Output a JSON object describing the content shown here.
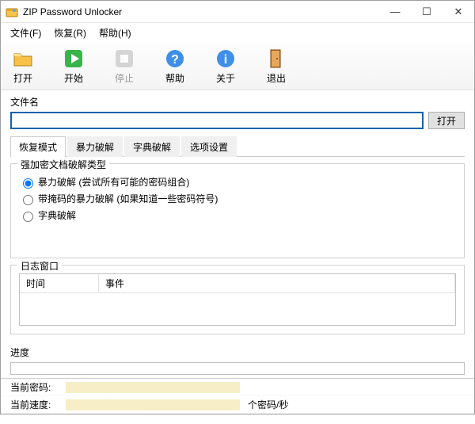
{
  "window": {
    "title": "ZIP Password Unlocker"
  },
  "menubar": {
    "items": [
      {
        "label": "文件(F)"
      },
      {
        "label": "恢复(R)"
      },
      {
        "label": "帮助(H)"
      }
    ]
  },
  "toolbar": {
    "buttons": [
      {
        "name": "open",
        "label": "打开",
        "icon": "folder-open-icon",
        "enabled": true
      },
      {
        "name": "start",
        "label": "开始",
        "icon": "play-icon",
        "enabled": true
      },
      {
        "name": "stop",
        "label": "停止",
        "icon": "stop-icon",
        "enabled": false
      },
      {
        "name": "help",
        "label": "帮助",
        "icon": "help-icon",
        "enabled": true
      },
      {
        "name": "about",
        "label": "关于",
        "icon": "info-icon",
        "enabled": true
      },
      {
        "name": "exit",
        "label": "退出",
        "icon": "door-exit-icon",
        "enabled": true
      }
    ]
  },
  "file": {
    "label": "文件名",
    "value": "",
    "open_button": "打开"
  },
  "tabs": {
    "items": [
      {
        "label": "恢复模式",
        "active": true
      },
      {
        "label": "暴力破解",
        "active": false
      },
      {
        "label": "字典破解",
        "active": false
      },
      {
        "label": "选项设置",
        "active": false
      }
    ]
  },
  "attack_group": {
    "legend": "强加密文档破解类型",
    "options": [
      {
        "label": "暴力破解 (尝试所有可能的密码组合)",
        "checked": true
      },
      {
        "label": "带掩码的暴力破解 (如果知道一些密码符号)",
        "checked": false
      },
      {
        "label": "字典破解",
        "checked": false
      }
    ]
  },
  "log": {
    "legend": "日志窗口",
    "columns": {
      "time": "时间",
      "event": "事件"
    }
  },
  "progress": {
    "label": "进度"
  },
  "status": {
    "current_password_label": "当前密码:",
    "current_speed_label": "当前速度:",
    "speed_unit": "个密码/秒"
  }
}
